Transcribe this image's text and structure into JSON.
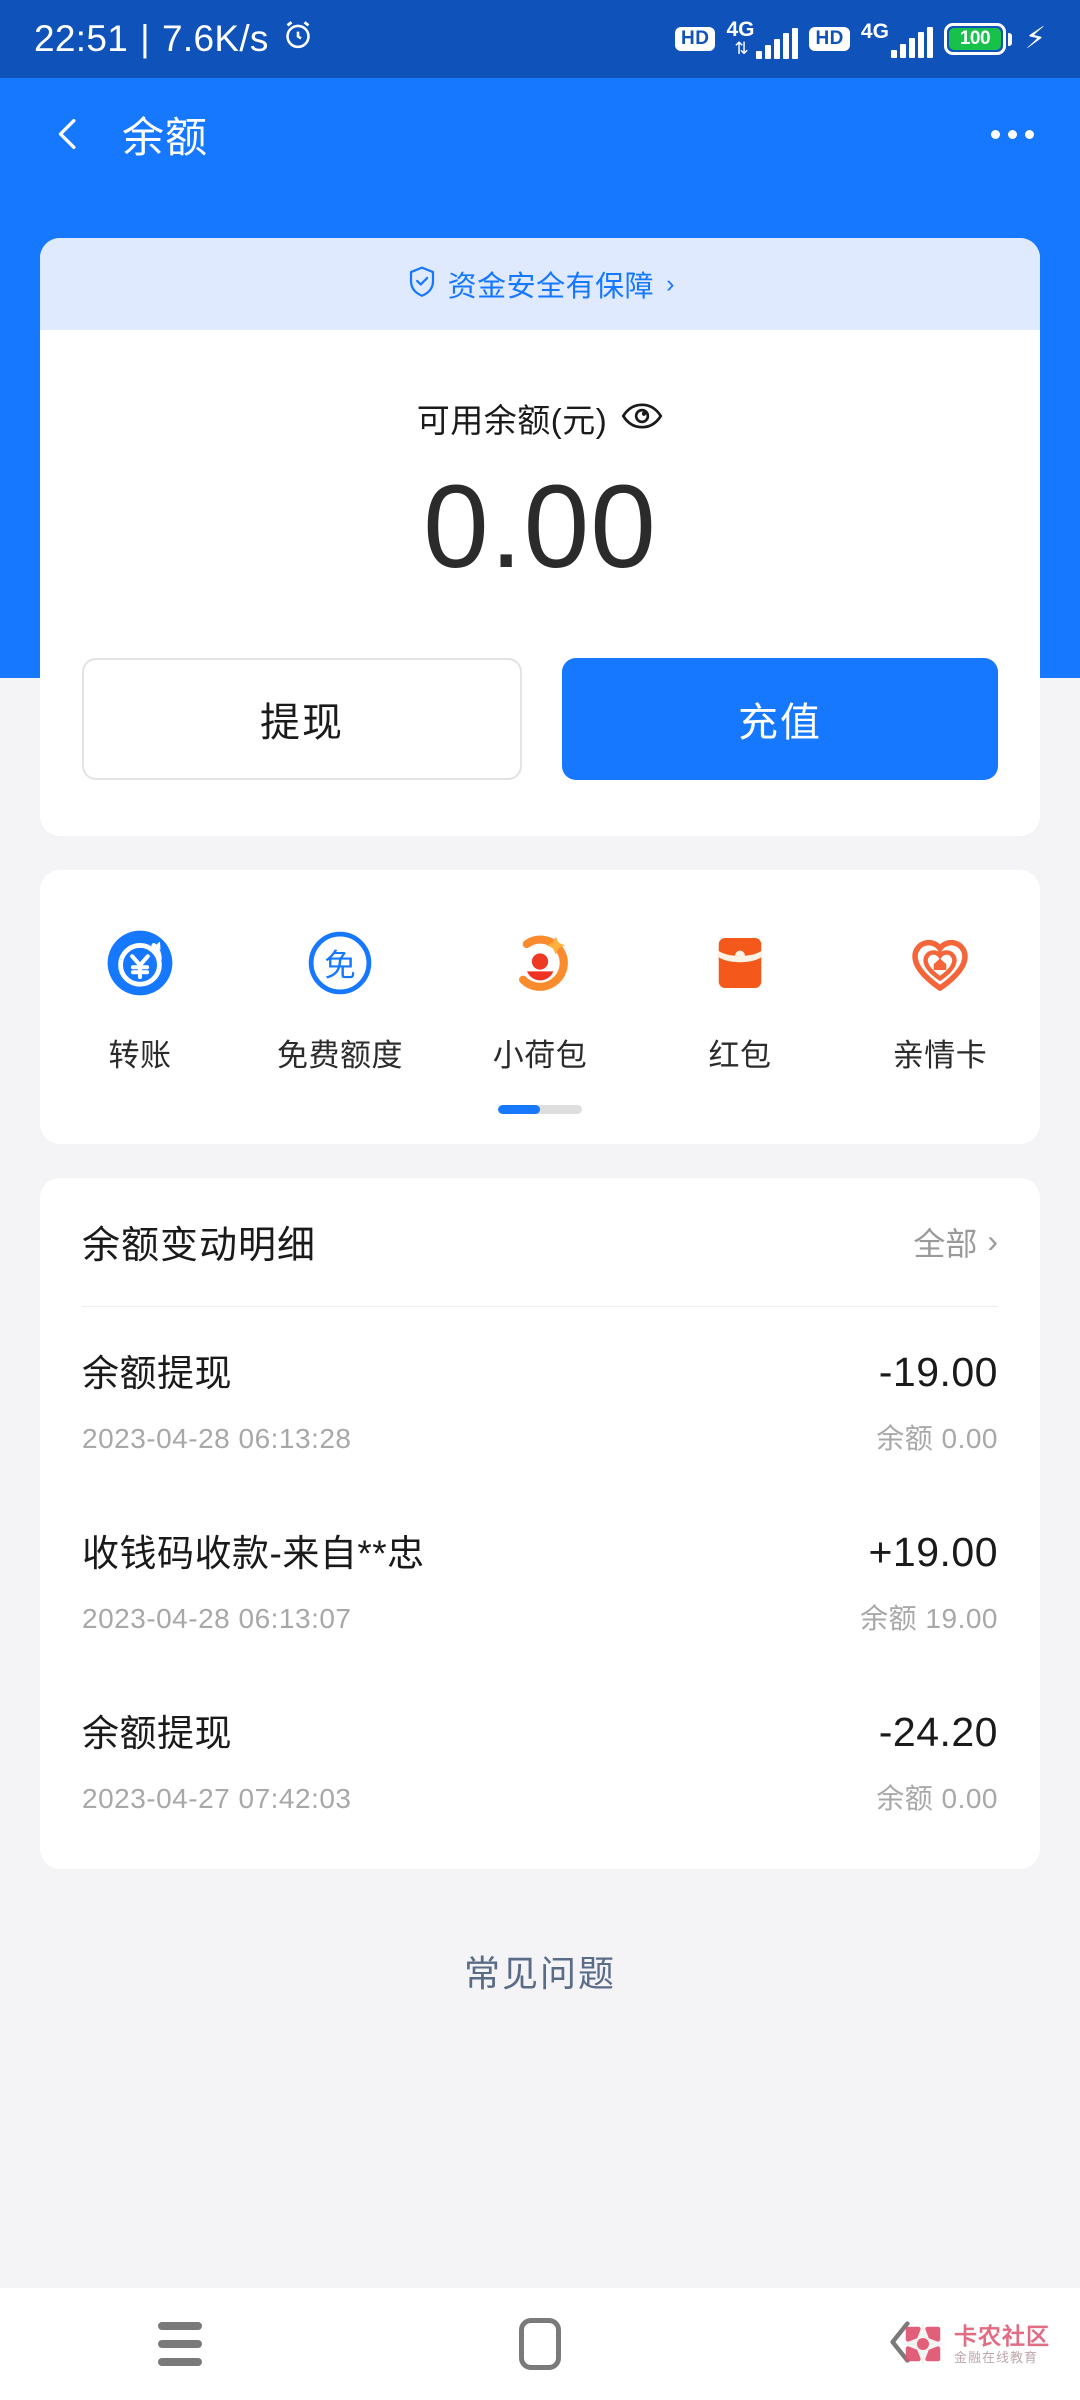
{
  "status_bar": {
    "time": "22:51",
    "separator": "|",
    "network_speed": "7.6K/s",
    "alarm_icon": "alarm-clock-icon",
    "sim1_hd": "HD",
    "sim1_network": "4G",
    "sim2_hd": "HD",
    "sim2_network": "4G",
    "battery_percent": "100",
    "charging_icon": "lightning-bolt-icon",
    "background_color": "#0f52ba"
  },
  "app_bar": {
    "back_icon": "back-chevron-icon",
    "title": "余额",
    "more_icon": "more-options-icon",
    "background_color": "#1677ff"
  },
  "balance_card": {
    "secure_banner": {
      "icon": "shield-check-icon",
      "text": "资金安全有保障",
      "arrow": "›",
      "background_color": "#dfeaff",
      "text_color": "#1677ff"
    },
    "label": "可用余额(元)",
    "eye_icon": "eye-icon",
    "amount": "0.00",
    "buttons": {
      "withdraw": "提现",
      "topup": "充值",
      "primary_color": "#1677ff"
    }
  },
  "shortcuts": {
    "items": [
      {
        "label": "转账",
        "icon": "transfer-yen-icon",
        "color": "#1677ff"
      },
      {
        "label": "免费额度",
        "icon": "free-quota-icon",
        "color": "#1677ff"
      },
      {
        "label": "小荷包",
        "icon": "small-wallet-icon",
        "color": "#ff6a2a"
      },
      {
        "label": "红包",
        "icon": "red-packet-icon",
        "color": "#f4591b"
      },
      {
        "label": "亲情卡",
        "icon": "family-card-heart-icon",
        "color": "#f4653a"
      }
    ],
    "pager": {
      "active_index": 0,
      "pages": 2
    }
  },
  "transactions": {
    "title": "余额变动明细",
    "all_label": "全部",
    "all_arrow": "›",
    "rows": [
      {
        "name": "余额提现",
        "amount": "-19.00",
        "time": "2023-04-28 06:13:28",
        "balance": "余额 0.00"
      },
      {
        "name": "收钱码收款-来自**忠",
        "amount": "+19.00",
        "time": "2023-04-28 06:13:07",
        "balance": "余额 19.00"
      },
      {
        "name": "余额提现",
        "amount": "-24.20",
        "time": "2023-04-27 07:42:03",
        "balance": "余额 0.00"
      }
    ]
  },
  "faq": {
    "label": "常见问题",
    "color": "#5a6b87"
  },
  "nav_bar": {
    "recents_icon": "hamburger-recents-icon",
    "home_icon": "home-square-icon",
    "back_icon": "nav-back-chevron-icon"
  },
  "watermark": {
    "title": "卡农社区",
    "subtitle": "金融在线教育"
  }
}
